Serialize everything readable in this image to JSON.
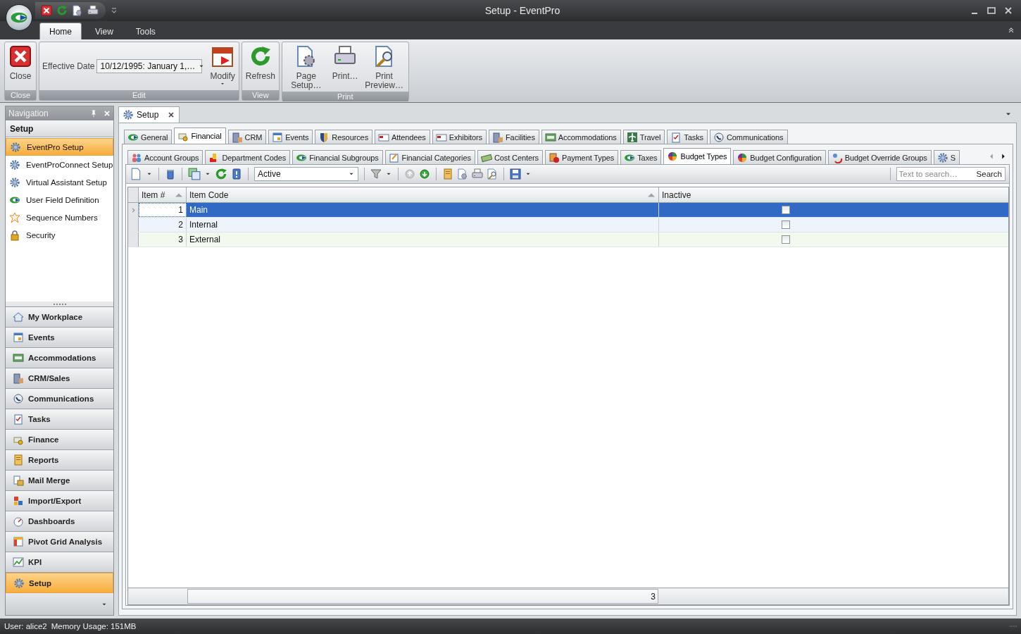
{
  "window": {
    "title": "Setup - EventPro"
  },
  "ribbon": {
    "tabs": [
      {
        "label": "Home",
        "selected": true
      },
      {
        "label": "View",
        "selected": false
      },
      {
        "label": "Tools",
        "selected": false
      }
    ],
    "groups": [
      {
        "caption": "Close",
        "items": [
          {
            "kind": "button",
            "label": "Close"
          }
        ]
      },
      {
        "caption": "Edit",
        "items": [
          {
            "kind": "combo",
            "label": "Effective Date",
            "value": "10/12/1995: January 1,…"
          },
          {
            "kind": "button",
            "label": "Modify",
            "dropdown": true
          }
        ]
      },
      {
        "caption": "View",
        "items": [
          {
            "kind": "button",
            "label": "Refresh"
          }
        ]
      },
      {
        "caption": "Print",
        "items": [
          {
            "kind": "button",
            "label": "Page Setup…"
          },
          {
            "kind": "button",
            "label": "Print…"
          },
          {
            "kind": "button",
            "label": "Print Preview…"
          }
        ]
      }
    ]
  },
  "navigation": {
    "title": "Navigation",
    "section": "Setup",
    "items": [
      {
        "label": "EventPro Setup",
        "selected": true
      },
      {
        "label": "EventProConnect Setup",
        "selected": false
      },
      {
        "label": "Virtual Assistant Setup",
        "selected": false
      },
      {
        "label": "User Field Definition",
        "selected": false
      },
      {
        "label": "Sequence Numbers",
        "selected": false
      },
      {
        "label": "Security",
        "selected": false
      }
    ],
    "modules": [
      {
        "label": "My Workplace",
        "selected": false
      },
      {
        "label": "Events",
        "selected": false
      },
      {
        "label": "Accommodations",
        "selected": false
      },
      {
        "label": "CRM/Sales",
        "selected": false
      },
      {
        "label": "Communications",
        "selected": false
      },
      {
        "label": "Tasks",
        "selected": false
      },
      {
        "label": "Finance",
        "selected": false
      },
      {
        "label": "Reports",
        "selected": false
      },
      {
        "label": "Mail Merge",
        "selected": false
      },
      {
        "label": "Import/Export",
        "selected": false
      },
      {
        "label": "Dashboards",
        "selected": false
      },
      {
        "label": "Pivot Grid Analysis",
        "selected": false
      },
      {
        "label": "KPI",
        "selected": false
      },
      {
        "label": "Setup",
        "selected": true
      }
    ]
  },
  "document": {
    "tab": "Setup",
    "tabs": [
      {
        "label": "General",
        "selected": false
      },
      {
        "label": "Financial",
        "selected": true
      },
      {
        "label": "CRM",
        "selected": false
      },
      {
        "label": "Events",
        "selected": false
      },
      {
        "label": "Resources",
        "selected": false
      },
      {
        "label": "Attendees",
        "selected": false
      },
      {
        "label": "Exhibitors",
        "selected": false
      },
      {
        "label": "Facilities",
        "selected": false
      },
      {
        "label": "Accommodations",
        "selected": false
      },
      {
        "label": "Travel",
        "selected": false
      },
      {
        "label": "Tasks",
        "selected": false
      },
      {
        "label": "Communications",
        "selected": false
      }
    ],
    "subtabs": [
      {
        "label": "Account Groups",
        "selected": false
      },
      {
        "label": "Department Codes",
        "selected": false
      },
      {
        "label": "Financial Subgroups",
        "selected": false
      },
      {
        "label": "Financial Categories",
        "selected": false
      },
      {
        "label": "Cost Centers",
        "selected": false
      },
      {
        "label": "Payment Types",
        "selected": false
      },
      {
        "label": "Taxes",
        "selected": false
      },
      {
        "label": "Budget Types",
        "selected": true
      },
      {
        "label": "Budget Configuration",
        "selected": false
      },
      {
        "label": "Budget Override Groups",
        "selected": false
      },
      {
        "label": "S",
        "selected": false
      }
    ],
    "toolbar": {
      "filter": "Active",
      "search": {
        "placeholder": "Text to search…"
      },
      "search_button": "Search"
    },
    "table": {
      "columns": [
        {
          "label": "Item #",
          "sorted": true
        },
        {
          "label": "Item Code",
          "sorted": true
        },
        {
          "label": "Inactive",
          "sorted": false
        }
      ],
      "rows": [
        {
          "item": "1",
          "code": "Main",
          "inactive": false,
          "selected": true
        },
        {
          "item": "2",
          "code": "Internal",
          "inactive": false,
          "selected": false
        },
        {
          "item": "3",
          "code": "External",
          "inactive": false,
          "selected": false
        }
      ],
      "footer_count": "3"
    }
  },
  "status_bar": {
    "user": "User: alice2",
    "memory": "Memory Usage: 151MB"
  }
}
